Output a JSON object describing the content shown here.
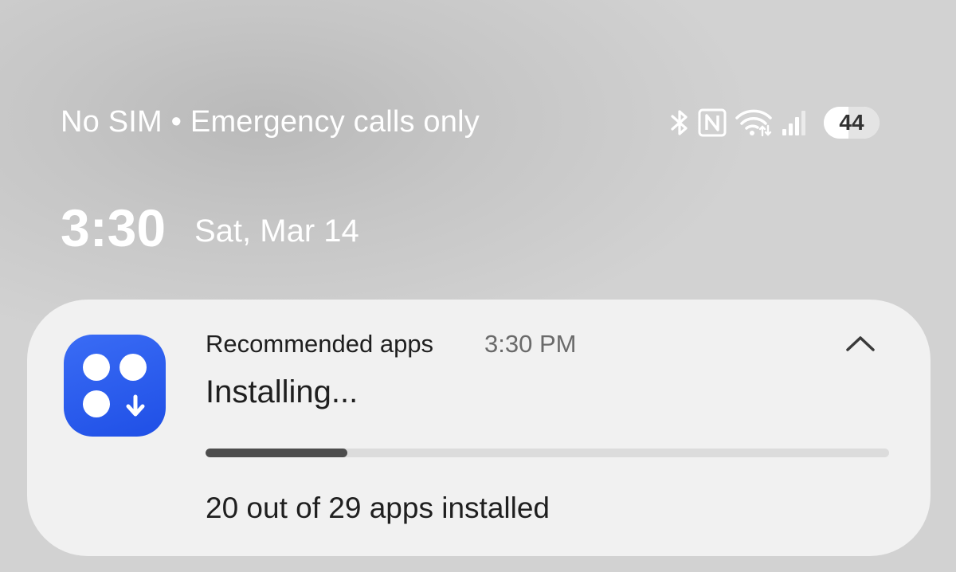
{
  "status_bar": {
    "carrier_text": "No SIM • Emergency calls only",
    "icons": [
      "bluetooth-icon",
      "nfc-icon",
      "wifi-icon",
      "signal-icon"
    ],
    "battery_level": "44"
  },
  "lock_screen": {
    "time": "3:30",
    "date": "Sat, Mar 14"
  },
  "notification": {
    "app_name": "Recommended apps",
    "timestamp": "3:30 PM",
    "title": "Installing...",
    "body": "20 out of 29 apps installed",
    "progress_fraction": 0.2069,
    "icon": "recommended-apps-icon",
    "icon_color": "#2d5ff0",
    "progress_color": "#4d4d4d",
    "progress_track_color": "#dcdcdc"
  }
}
